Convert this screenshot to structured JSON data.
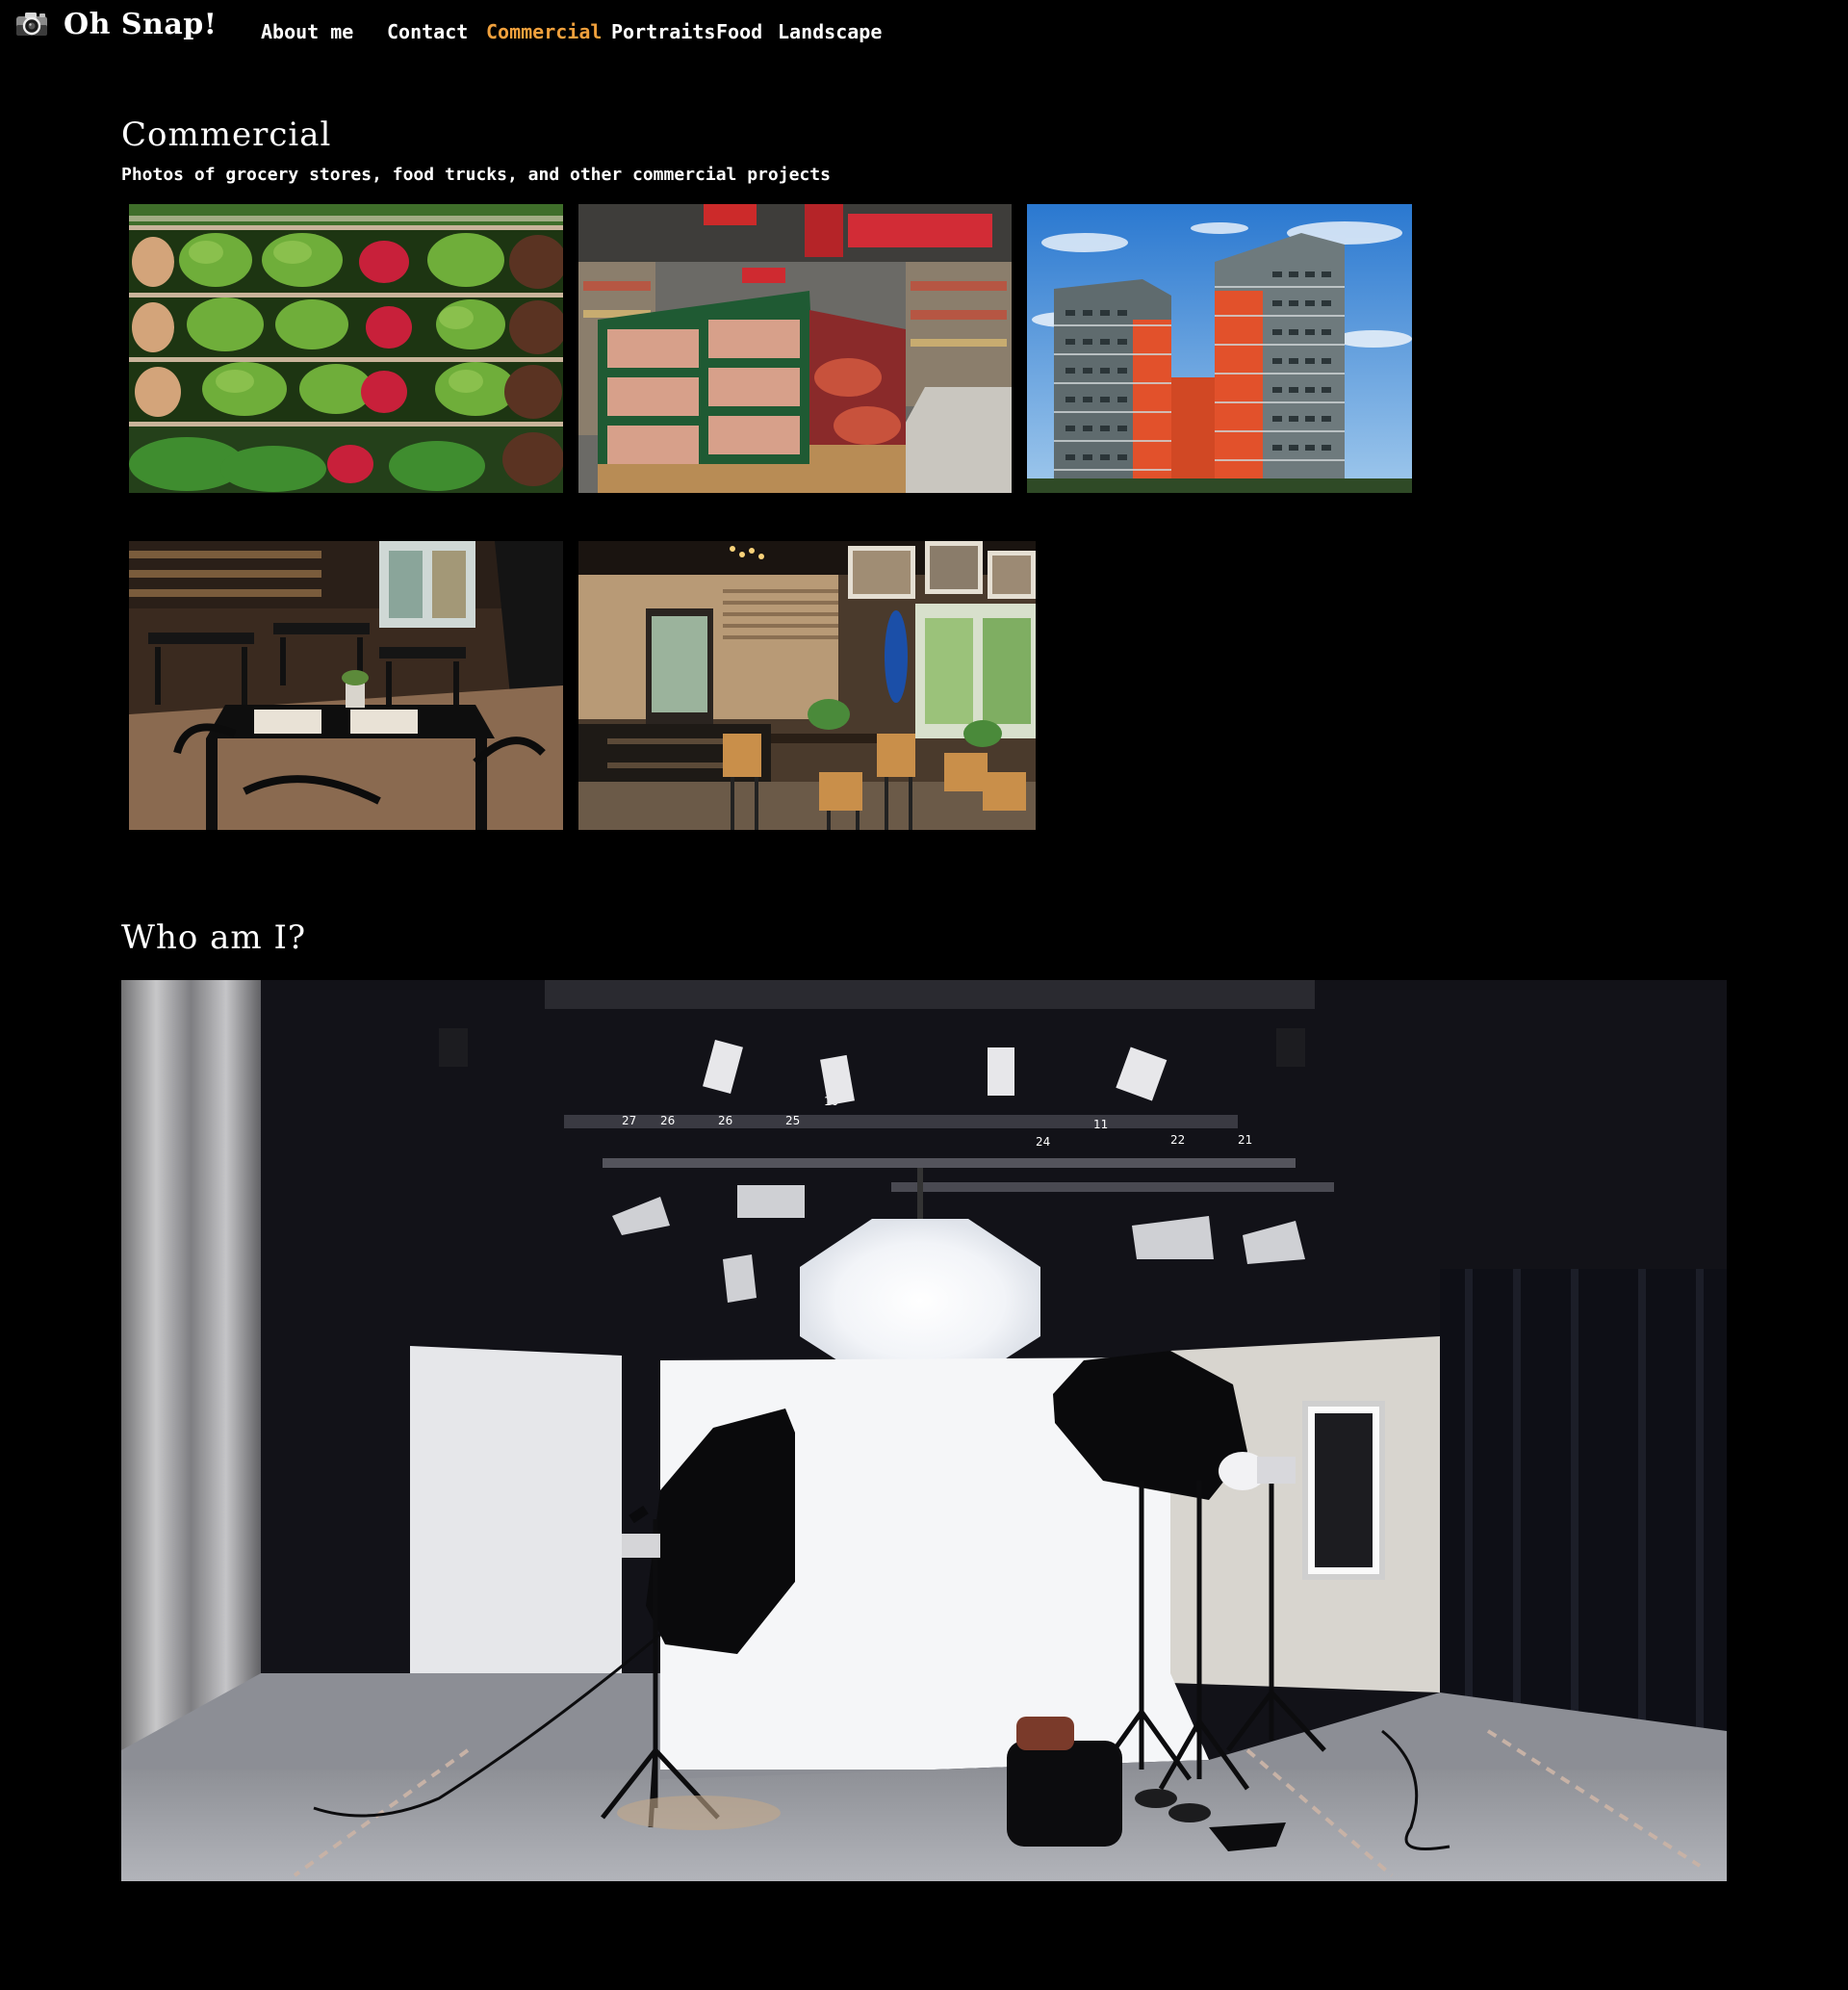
{
  "header": {
    "logo_text": "Oh Snap!",
    "logo_icon": "camera-icon",
    "nav": {
      "about": "About me",
      "contact": "Contact",
      "commercial": "Commercial",
      "portraits": "Portraits",
      "food": "Food",
      "landscape": "Landscape"
    },
    "active_nav": "Commercial"
  },
  "commercial": {
    "title": "Commercial",
    "subtitle": "Photos of grocery stores, food trucks, and other commercial projects"
  },
  "gallery_photos": [
    "grocery-produce-shelves",
    "supermarket-produce-aisle",
    "apartment-towers",
    "restaurant-tables",
    "cafe-interior"
  ],
  "who": {
    "title": "Who am I?"
  },
  "colors": {
    "background": "#000000",
    "text": "#ffffff",
    "active_nav": "#f0a03c"
  }
}
